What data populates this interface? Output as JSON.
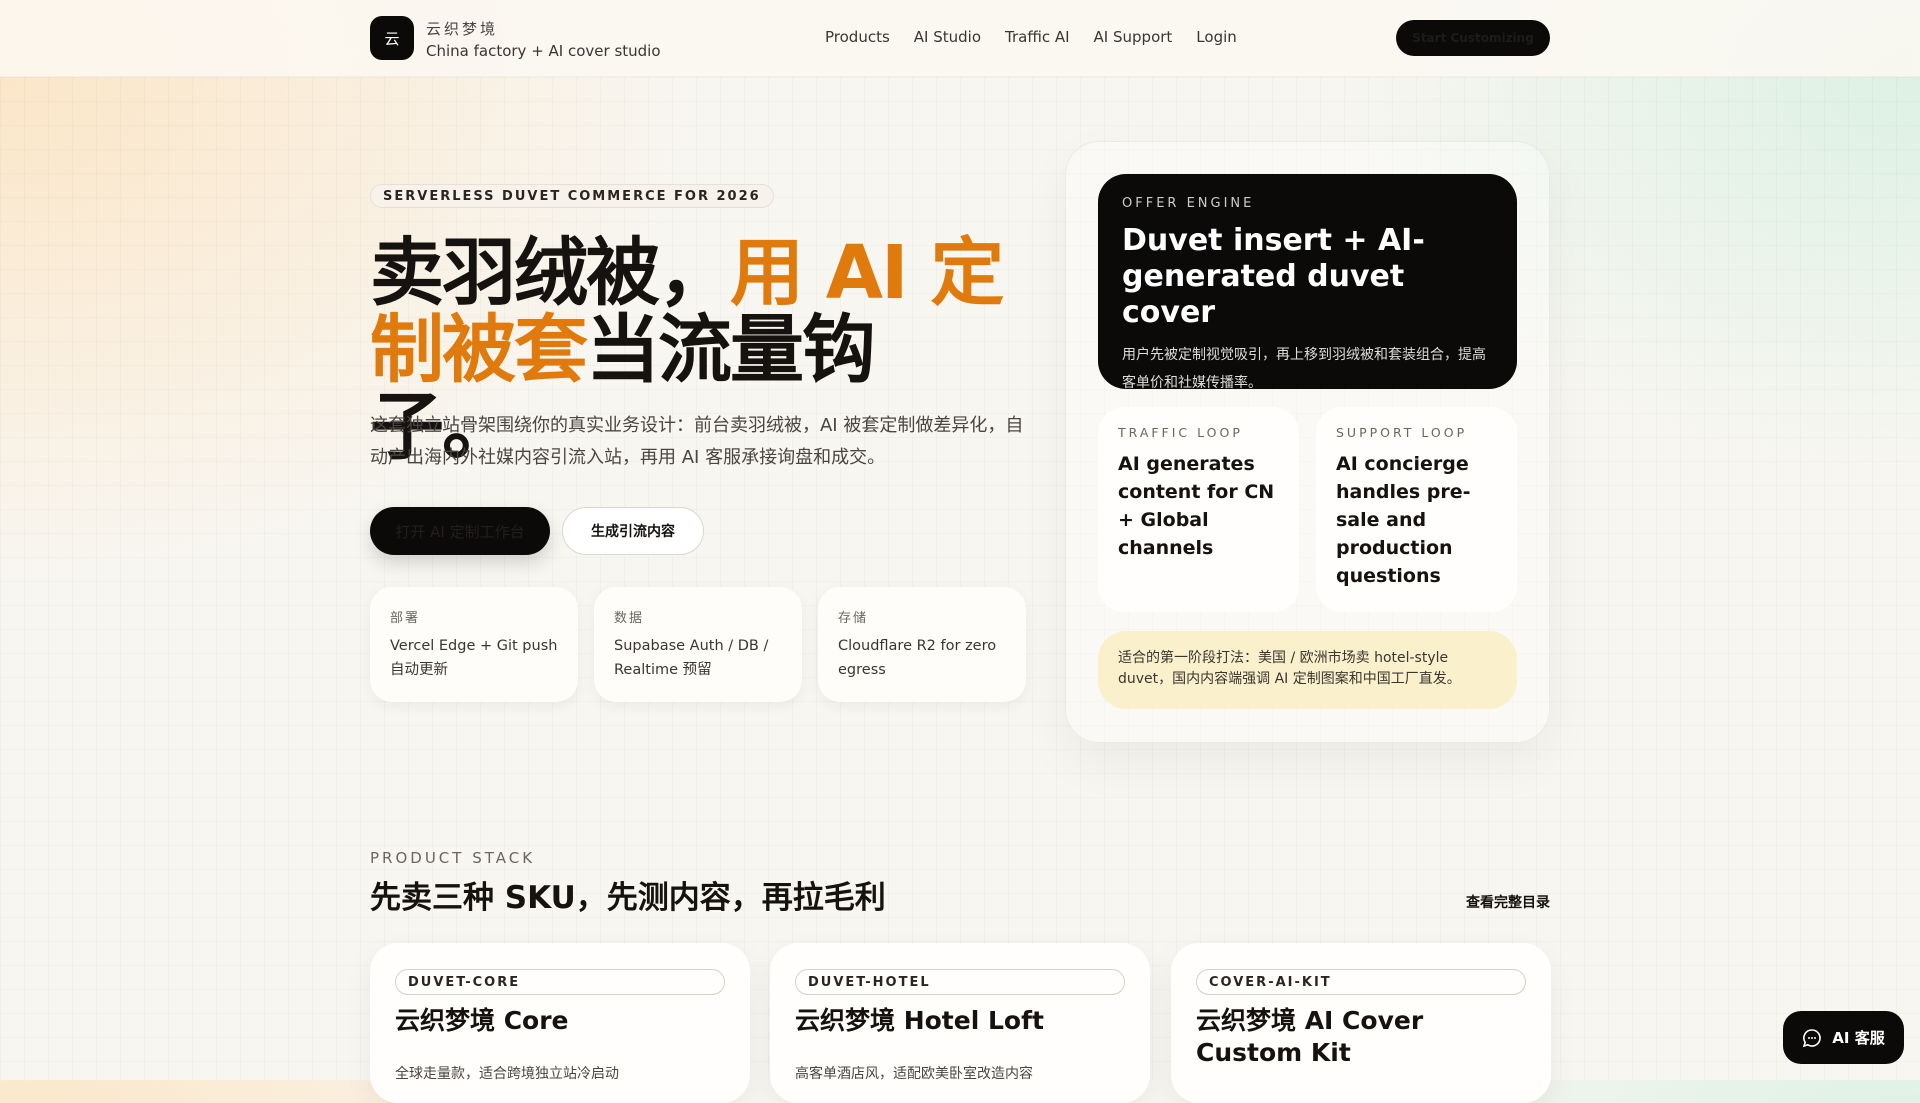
{
  "header": {
    "logo_glyph": "云",
    "brand_name": "云织梦境",
    "brand_tagline": "China factory + AI cover studio",
    "nav": [
      "Products",
      "AI Studio",
      "Traffic AI",
      "AI Support",
      "Login"
    ],
    "cta": "Start Customizing"
  },
  "hero": {
    "badge": "SERVERLESS DUVET COMMERCE FOR 2026",
    "title_1": "卖羽绒被，",
    "title_2": "用 AI 定制被套",
    "title_3": "当流量钩子。",
    "lead": "这套独立站骨架围绕你的真实业务设计：前台卖羽绒被，AI 被套定制做差异化，自动产出海内外社媒内容引流入站，再用 AI 客服承接询盘和成交。",
    "primary_btn": "打开 AI 定制工作台",
    "secondary_btn": "生成引流内容",
    "stack": [
      {
        "k": "部署",
        "v": "Vercel Edge + Git push 自动更新"
      },
      {
        "k": "数据",
        "v": "Supabase Auth / DB / Realtime 预留"
      },
      {
        "k": "存储",
        "v": "Cloudflare R2 for zero egress"
      }
    ]
  },
  "panel": {
    "offer_label": "OFFER ENGINE",
    "offer_title": "Duvet insert + AI-generated duvet cover",
    "offer_desc": "用户先被定制视觉吸引，再上移到羽绒被和套装组合，提高客单价和社媒传播率。",
    "traffic_label": "TRAFFIC LOOP",
    "traffic_text": "AI generates content for CN + Global channels",
    "support_label": "SUPPORT LOOP",
    "support_text": "AI concierge handles pre-sale and production questions",
    "note": "适合的第一阶段打法：美国 / 欧洲市场卖 hotel-style duvet，国内内容端强调 AI 定制图案和中国工厂直发。"
  },
  "products": {
    "eyebrow": "PRODUCT STACK",
    "title": "先卖三种 SKU，先测内容，再拉毛利",
    "more": "查看完整目录",
    "items": [
      {
        "sku": "DUVET-CORE",
        "name": "云织梦境 Core",
        "desc": "全球走量款，适合跨境独立站冷启动"
      },
      {
        "sku": "DUVET-HOTEL",
        "name": "云织梦境 Hotel Loft",
        "desc": "高客单酒店风，适配欧美卧室改造内容"
      },
      {
        "sku": "COVER-AI-KIT",
        "name": "云织梦境 AI Cover Custom Kit",
        "desc": ""
      }
    ]
  },
  "chat": {
    "label": "AI 客服"
  }
}
